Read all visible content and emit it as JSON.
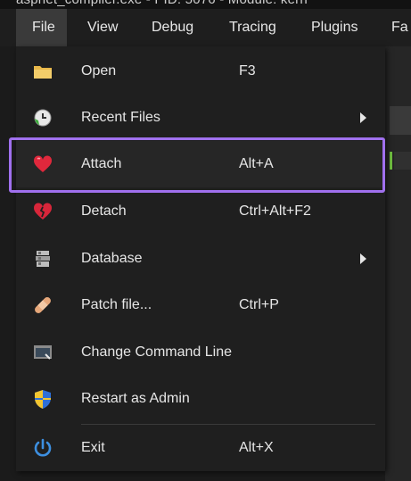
{
  "window": {
    "title": "aspnet_compiler.exe - PID: 5076 - Module: kern"
  },
  "menubar": {
    "items": [
      "File",
      "View",
      "Debug",
      "Tracing",
      "Plugins",
      "Fa"
    ]
  },
  "file_menu": {
    "items": [
      {
        "label": "Open",
        "shortcut": "F3",
        "icon": "folder-icon"
      },
      {
        "label": "Recent Files",
        "shortcut": "",
        "icon": "recent-files-icon",
        "submenu": true
      },
      {
        "label": "Attach",
        "shortcut": "Alt+A",
        "icon": "heart-icon",
        "highlighted": true
      },
      {
        "label": "Detach",
        "shortcut": "Ctrl+Alt+F2",
        "icon": "broken-heart-icon"
      },
      {
        "label": "Database",
        "shortcut": "",
        "icon": "database-icon",
        "submenu": true
      },
      {
        "label": "Patch file...",
        "shortcut": "Ctrl+P",
        "icon": "bandage-icon"
      },
      {
        "label": "Change Command Line",
        "shortcut": "",
        "icon": "command-line-icon"
      },
      {
        "label": "Restart as Admin",
        "shortcut": "",
        "icon": "shield-icon"
      },
      {
        "label": "Exit",
        "shortcut": "Alt+X",
        "icon": "power-icon"
      }
    ]
  },
  "colors": {
    "highlight_border": "#a070ee",
    "background": "#1f1f1f",
    "text": "#e6e6e6"
  }
}
